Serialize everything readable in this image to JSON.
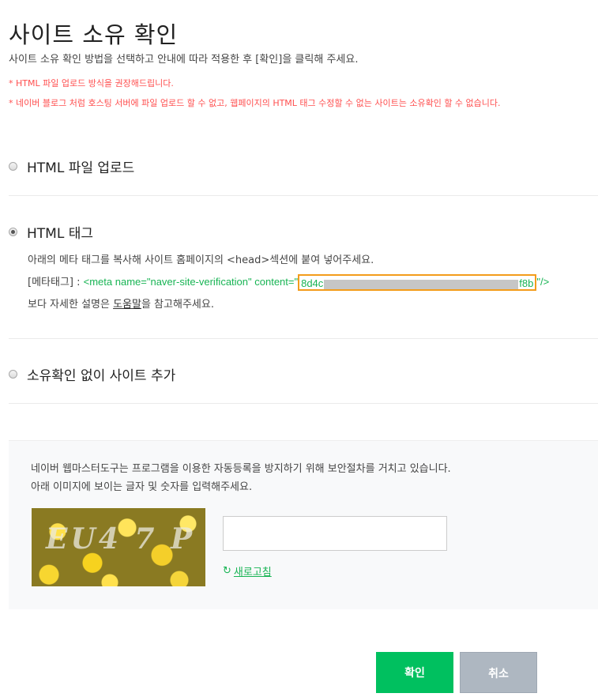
{
  "page": {
    "title": "사이트 소유 확인",
    "description": "사이트 소유 확인 방법을 선택하고 안내에 따라 적용한 후 [확인]을 클릭해 주세요.",
    "notes": [
      "* HTML 파일 업로드 방식을 권장해드립니다.",
      "* 네이버 블로그 처럼 호스팅 서버에 파일 업로드 할 수 없고, 웹페이지의 HTML 태그 수정할 수 없는 사이트는 소유확인 할 수 없습니다."
    ]
  },
  "options": {
    "html_file": {
      "label": "HTML 파일 업로드",
      "checked": false
    },
    "html_tag": {
      "label": "HTML 태그",
      "checked": true,
      "instruction": "아래의 메타 태그를 복사해 사이트 홈페이지의 <head>섹션에 붙여 넣어주세요.",
      "meta_prefix": "[메타태그] : ",
      "meta_code_start": "<meta name=\"naver-site-verification\" content=\"",
      "token_head": "8d4c",
      "token_tail": "f8b",
      "meta_code_end": "\"/>",
      "help_before": "보다 자세한 설명은 ",
      "help_link": "도움말",
      "help_after": "을 참고해주세요."
    },
    "no_verify": {
      "label": "소유확인 없이 사이트 추가",
      "checked": false
    }
  },
  "captcha": {
    "line1": "네이버 웹마스터도구는 프로그램을 이용한 자동등록을 방지하기 위해 보안절차를 거치고 있습니다.",
    "line2": "아래 이미지에 보이는 글자 및 숫자를 입력해주세요.",
    "image_text": "EU4 7 P",
    "input_value": "",
    "refresh_label": "새로고침",
    "refresh_icon": "refresh-icon"
  },
  "buttons": {
    "ok": "확인",
    "cancel": "취소"
  },
  "colors": {
    "accent_green": "#00c05f",
    "code_green": "#18b454",
    "warning_red": "#ff4f4f",
    "highlight_orange": "#f39c1b",
    "cancel_gray": "#aeb7c1"
  }
}
